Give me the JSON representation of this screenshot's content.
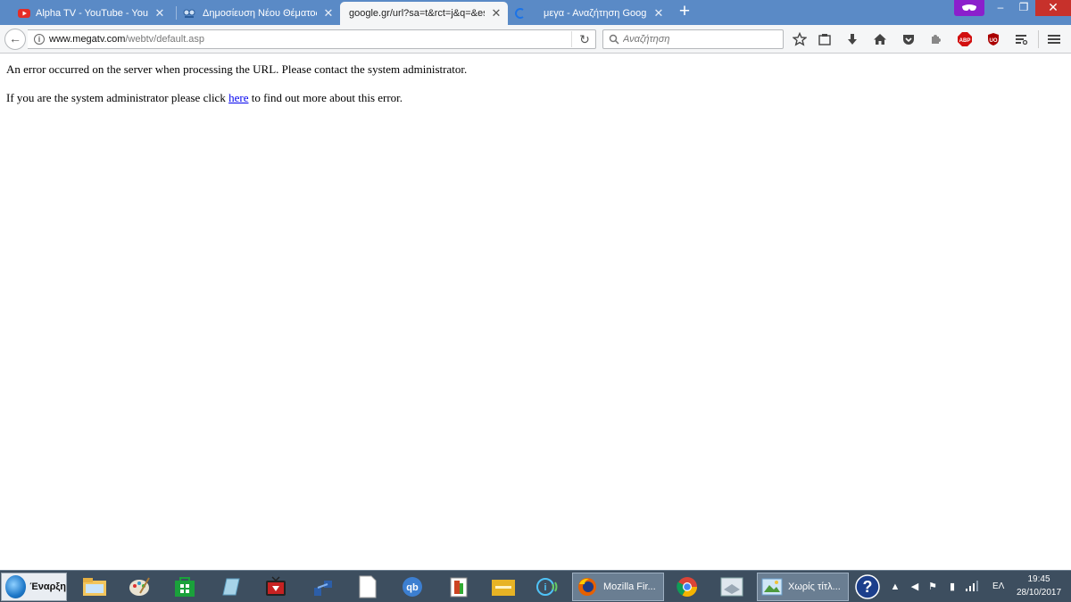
{
  "browser": {
    "tabs": [
      {
        "title": "Alpha TV - YouTube - YouTube",
        "icon": "youtube-icon",
        "active": false
      },
      {
        "title": "Δημοσίευση Νέου Θέματος",
        "icon": "forum-icon",
        "active": false
      },
      {
        "title": "google.gr/url?sa=t&rct=j&q=&esrc=s",
        "icon": "none",
        "active": true
      },
      {
        "title": "μεγα - Αναζήτηση Google",
        "icon": "loading-icon",
        "active": false
      }
    ],
    "url_host": "www.megatv.com",
    "url_path": "/webtv/default.asp",
    "search_placeholder": "Αναζήτηση"
  },
  "page": {
    "line1": "An error occurred on the server when processing the URL. Please contact the system administrator.",
    "line2_before": "If you are the system administrator please click ",
    "line2_link": "here",
    "line2_after": " to find out more about this error."
  },
  "taskbar": {
    "start_label": "Έναρξη",
    "tasks": [
      {
        "label": "Mozilla Fir...",
        "icon": "firefox-icon"
      },
      {
        "label": "Χωρίς τίτλ...",
        "icon": "paint-icon"
      }
    ],
    "language": "ΕΛ",
    "time": "19:45",
    "date": "28/10/2017"
  },
  "colors": {
    "tabstrip": "#5a8ac6",
    "close": "#c7312b",
    "private": "#8b1fcc",
    "link": "#0000ee",
    "taskbar": "#3d4e5f"
  }
}
